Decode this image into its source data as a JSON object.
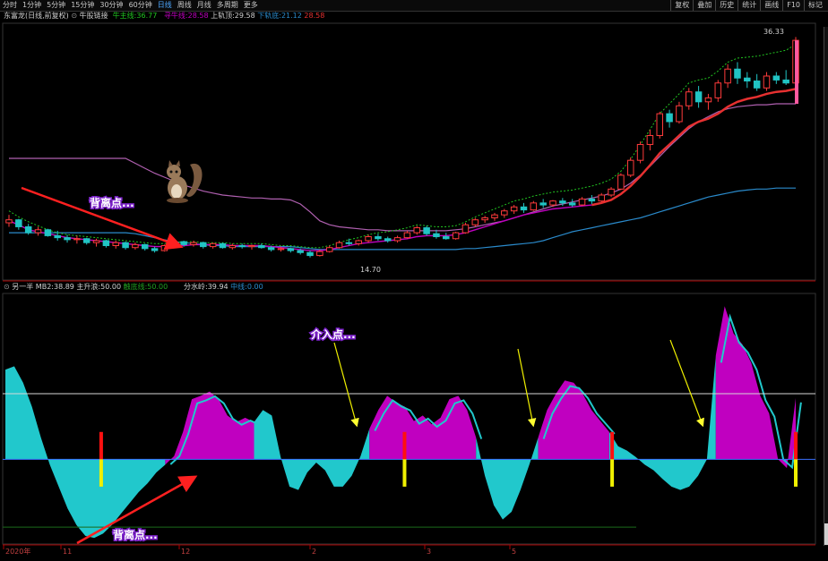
{
  "toolbar": {
    "items": [
      {
        "label": "分时",
        "active": false
      },
      {
        "label": "1分钟",
        "active": false
      },
      {
        "label": "5分钟",
        "active": false
      },
      {
        "label": "15分钟",
        "active": false
      },
      {
        "label": "30分钟",
        "active": false
      },
      {
        "label": "60分钟",
        "active": false
      },
      {
        "label": "日线",
        "active": true
      },
      {
        "label": "周线",
        "active": false
      },
      {
        "label": "月线",
        "active": false
      },
      {
        "label": "多周期",
        "active": false
      },
      {
        "label": "更多",
        "active": false
      }
    ],
    "right_items": [
      "复权",
      "叠加",
      "历史",
      "统计",
      "画线",
      "F10",
      "标记"
    ]
  },
  "colors": {
    "up": "#ff3b3b",
    "down": "#21c4c4",
    "magenta": "#c000c0",
    "cyan": "#21c8cc",
    "mid": "#f5f5f5",
    "ma": "#e63030",
    "upper_band": "#b060b0",
    "lower_band": "#2a8acb",
    "yellow": "#f0f000"
  },
  "main_info": {
    "stock": "东富龙(日线,前复权)",
    "indicator": "牛股链接",
    "bull_label": "牛主线:",
    "bull_value": "36.77",
    "seek_label": "寻牛线:",
    "seek_value": "28.58",
    "upper_label": "上轨顶:",
    "upper_value": "29.58",
    "lower_label": "下轨底:",
    "lower_value": "21.12",
    "extra_value": "28.58"
  },
  "sub_info": {
    "name": "另一半",
    "mb2_label": "MB2:",
    "mb2_value": "38.89",
    "main_label": "主升浪:",
    "main_value": "50.00",
    "support_label": "触底线:",
    "support_value": "50.00",
    "water_label": "分水岭:",
    "water_value": "39.94",
    "mid_label": "中线:",
    "mid_value": "0.00"
  },
  "annotations": {
    "top_divergence": "背离点...",
    "entry": "介入点...",
    "bottom_divergence": "背离点..."
  },
  "chart_data": [
    {
      "type": "candlestick",
      "title": "东富龙(日线,前复权)",
      "max_label": "36.33",
      "min_label": "14.70",
      "ylim": [
        13,
        37
      ],
      "candles": [
        [
          17.6,
          18.4,
          17.2,
          17.9
        ],
        [
          17.9,
          18.0,
          16.9,
          17.2
        ],
        [
          17.2,
          17.5,
          16.4,
          16.6
        ],
        [
          16.6,
          17.2,
          16.3,
          16.9
        ],
        [
          16.9,
          17.0,
          16.2,
          16.3
        ],
        [
          16.3,
          16.8,
          15.8,
          16.1
        ],
        [
          16.1,
          16.4,
          15.6,
          15.9
        ],
        [
          15.9,
          16.3,
          15.5,
          16.0
        ],
        [
          16.0,
          16.1,
          15.4,
          15.6
        ],
        [
          15.6,
          16.0,
          15.2,
          15.8
        ],
        [
          15.8,
          15.9,
          15.1,
          15.3
        ],
        [
          15.3,
          15.8,
          15.0,
          15.6
        ],
        [
          15.6,
          15.7,
          14.9,
          15.1
        ],
        [
          15.1,
          15.6,
          14.9,
          15.4
        ],
        [
          15.4,
          15.5,
          14.8,
          15.0
        ],
        [
          15.0,
          15.2,
          14.6,
          14.8
        ],
        [
          14.8,
          15.4,
          14.7,
          15.3
        ],
        [
          15.3,
          15.9,
          15.1,
          15.7
        ],
        [
          15.7,
          15.8,
          15.2,
          15.4
        ],
        [
          15.4,
          15.8,
          15.2,
          15.6
        ],
        [
          15.6,
          15.7,
          15.0,
          15.2
        ],
        [
          15.2,
          15.6,
          15.0,
          15.5
        ],
        [
          15.5,
          15.6,
          15.0,
          15.1
        ],
        [
          15.1,
          15.5,
          14.9,
          15.3
        ],
        [
          15.3,
          15.5,
          15.0,
          15.2
        ],
        [
          15.2,
          15.4,
          14.9,
          15.3
        ],
        [
          15.3,
          15.5,
          15.0,
          15.1
        ],
        [
          15.1,
          15.3,
          14.7,
          14.9
        ],
        [
          14.9,
          15.2,
          14.7,
          15.0
        ],
        [
          15.0,
          15.1,
          14.6,
          14.8
        ],
        [
          14.8,
          15.0,
          14.4,
          14.6
        ],
        [
          14.6,
          14.8,
          14.1,
          14.3
        ],
        [
          14.3,
          14.9,
          14.2,
          14.7
        ],
        [
          14.7,
          15.3,
          14.6,
          15.1
        ],
        [
          15.1,
          15.8,
          15.0,
          15.6
        ],
        [
          15.6,
          16.0,
          15.3,
          15.5
        ],
        [
          15.5,
          15.9,
          15.3,
          15.8
        ],
        [
          15.8,
          16.4,
          15.6,
          16.2
        ],
        [
          16.2,
          16.5,
          15.8,
          16.0
        ],
        [
          16.0,
          16.2,
          15.6,
          15.8
        ],
        [
          15.8,
          16.3,
          15.6,
          16.1
        ],
        [
          16.1,
          16.8,
          16.0,
          16.6
        ],
        [
          16.6,
          17.3,
          16.4,
          17.1
        ],
        [
          17.1,
          17.3,
          16.3,
          16.5
        ],
        [
          16.5,
          16.9,
          16.0,
          16.2
        ],
        [
          16.2,
          16.6,
          15.9,
          16.0
        ],
        [
          16.0,
          16.7,
          15.9,
          16.6
        ],
        [
          16.6,
          17.6,
          16.5,
          17.4
        ],
        [
          17.4,
          18.1,
          17.2,
          17.9
        ],
        [
          17.9,
          18.3,
          17.6,
          18.1
        ],
        [
          18.1,
          18.6,
          17.8,
          18.4
        ],
        [
          18.4,
          19.0,
          18.1,
          18.8
        ],
        [
          18.8,
          19.4,
          18.5,
          19.2
        ],
        [
          19.2,
          19.6,
          18.6,
          18.9
        ],
        [
          18.9,
          19.8,
          18.8,
          19.6
        ],
        [
          19.6,
          20.0,
          19.1,
          19.4
        ],
        [
          19.4,
          19.9,
          19.2,
          19.8
        ],
        [
          19.8,
          20.1,
          19.3,
          19.6
        ],
        [
          19.6,
          20.0,
          19.2,
          19.4
        ],
        [
          19.4,
          20.2,
          19.3,
          20.0
        ],
        [
          20.0,
          20.4,
          19.5,
          19.8
        ],
        [
          19.8,
          20.6,
          19.7,
          20.4
        ],
        [
          20.4,
          21.2,
          20.2,
          21.0
        ],
        [
          21.0,
          22.6,
          20.9,
          22.4
        ],
        [
          22.4,
          24.2,
          22.2,
          23.9
        ],
        [
          23.9,
          25.8,
          23.6,
          25.5
        ],
        [
          25.5,
          27.0,
          24.9,
          26.4
        ],
        [
          26.4,
          28.8,
          26.1,
          28.6
        ],
        [
          28.6,
          29.0,
          27.2,
          27.8
        ],
        [
          27.8,
          29.8,
          27.6,
          29.4
        ],
        [
          29.4,
          31.2,
          29.0,
          30.8
        ],
        [
          30.8,
          31.4,
          29.2,
          29.8
        ],
        [
          29.8,
          30.6,
          29.0,
          30.2
        ],
        [
          30.2,
          32.0,
          29.8,
          31.7
        ],
        [
          31.7,
          33.6,
          31.2,
          33.1
        ],
        [
          33.1,
          33.8,
          31.6,
          32.2
        ],
        [
          32.2,
          32.8,
          31.2,
          31.9
        ],
        [
          31.9,
          32.6,
          30.9,
          31.2
        ],
        [
          31.2,
          32.8,
          30.9,
          32.4
        ],
        [
          32.4,
          32.8,
          31.6,
          32.0
        ],
        [
          32.0,
          33.0,
          31.5,
          31.7
        ],
        [
          31.7,
          36.33,
          31.4,
          36.0
        ]
      ],
      "seek_line": [
        17.8,
        17.4,
        16.9,
        16.7,
        16.5,
        16.3,
        16.1,
        16.0,
        15.9,
        15.8,
        15.7,
        15.6,
        15.5,
        15.4,
        15.3,
        15.2,
        15.2,
        15.3,
        15.3,
        15.4,
        15.4,
        15.4,
        15.4,
        15.3,
        15.3,
        15.3,
        15.3,
        15.2,
        15.1,
        15.0,
        14.9,
        14.8,
        14.8,
        14.9,
        15.1,
        15.3,
        15.5,
        15.6,
        15.7,
        15.8,
        15.9,
        16.0,
        16.2,
        16.3,
        16.3,
        16.3,
        16.4,
        16.6,
        16.9,
        17.2,
        17.5,
        17.8,
        18.1,
        18.4,
        18.6,
        18.8,
        19.0,
        19.1,
        19.2,
        19.3,
        19.4,
        19.6,
        19.9,
        20.5,
        21.3,
        22.3,
        23.4,
        24.6,
        25.5,
        26.4,
        27.3,
        27.8,
        28.1,
        28.6,
        29.3,
        29.8,
        30.1,
        30.3,
        30.6,
        30.8,
        30.9,
        31.1
      ],
      "upper_band": [
        24.1,
        24.1,
        24.1,
        24.1,
        24.1,
        24.1,
        24.1,
        24.1,
        24.1,
        24.1,
        24.1,
        24.1,
        24.1,
        23.6,
        23.1,
        22.6,
        22.2,
        21.8,
        21.4,
        21.1,
        20.8,
        20.6,
        20.4,
        20.3,
        20.2,
        20.1,
        20.1,
        20.0,
        20.0,
        19.9,
        19.5,
        18.7,
        17.8,
        17.4,
        17.2,
        17.1,
        17.0,
        16.9,
        16.9,
        16.8,
        16.8,
        16.8,
        16.8,
        16.8,
        16.8,
        16.8,
        16.9,
        17.0,
        17.2,
        17.4,
        17.6,
        17.8,
        18.1,
        18.4,
        18.7,
        19.0,
        19.3,
        19.5,
        19.7,
        19.9,
        20.1,
        20.3,
        20.6,
        21.0,
        21.6,
        22.4,
        23.3,
        24.3,
        25.3,
        26.2,
        27.1,
        27.8,
        28.3,
        28.8,
        29.1,
        29.3,
        29.4,
        29.5,
        29.5,
        29.6,
        29.6,
        29.6
      ],
      "lower_band": [
        16.6,
        16.6,
        16.6,
        16.6,
        16.6,
        16.6,
        16.6,
        16.6,
        16.6,
        16.6,
        16.6,
        16.6,
        16.6,
        16.5,
        16.3,
        16.1,
        15.9,
        15.7,
        15.6,
        15.5,
        15.4,
        15.3,
        15.3,
        15.2,
        15.2,
        15.2,
        15.2,
        15.2,
        15.2,
        15.2,
        15.1,
        15.0,
        14.9,
        14.9,
        14.9,
        14.9,
        14.9,
        14.9,
        14.9,
        14.9,
        14.9,
        14.9,
        14.9,
        14.9,
        14.9,
        14.9,
        14.9,
        15.0,
        15.0,
        15.1,
        15.2,
        15.3,
        15.4,
        15.5,
        15.6,
        15.8,
        16.1,
        16.4,
        16.7,
        16.9,
        17.1,
        17.3,
        17.5,
        17.7,
        17.9,
        18.1,
        18.4,
        18.7,
        19.0,
        19.3,
        19.6,
        19.9,
        20.2,
        20.4,
        20.6,
        20.8,
        20.9,
        21.0,
        21.0,
        21.1,
        21.1,
        21.1
      ],
      "dotted_line": [
        18.8,
        18.2,
        17.7,
        17.3,
        16.9,
        16.6,
        16.4,
        16.3,
        16.2,
        16.1,
        16.0,
        15.9,
        15.8,
        15.7,
        15.6,
        15.5,
        15.5,
        15.6,
        15.7,
        15.7,
        15.6,
        15.6,
        15.6,
        15.5,
        15.5,
        15.5,
        15.5,
        15.4,
        15.3,
        15.3,
        15.2,
        15.1,
        15.1,
        15.3,
        15.6,
        15.9,
        16.1,
        16.4,
        16.6,
        16.7,
        16.9,
        17.1,
        17.4,
        17.3,
        17.2,
        17.2,
        17.3,
        17.7,
        18.2,
        18.6,
        19.0,
        19.4,
        19.8,
        20.0,
        20.3,
        20.5,
        20.7,
        20.8,
        20.9,
        21.1,
        21.3,
        21.6,
        22.0,
        22.8,
        24.0,
        25.5,
        27.0,
        28.6,
        29.6,
        30.6,
        31.7,
        32.0,
        32.2,
        32.9,
        33.8,
        34.2,
        34.3,
        34.4,
        34.6,
        34.8,
        35.0,
        35.6
      ]
    },
    {
      "type": "area",
      "title": "另一半",
      "ylim": [
        -75,
        150
      ],
      "reference_lines": [
        {
          "name": "分水岭",
          "value": 60
        },
        {
          "name": "中线",
          "value": 0
        }
      ],
      "values": [
        82,
        85,
        70,
        48,
        20,
        -5,
        -25,
        -45,
        -60,
        -70,
        -72,
        -68,
        -60,
        -50,
        -40,
        -30,
        -22,
        -12,
        -5,
        3,
        25,
        55,
        58,
        62,
        55,
        40,
        34,
        38,
        34,
        45,
        40,
        2,
        -25,
        -28,
        -12,
        -3,
        -10,
        -25,
        -25,
        -15,
        3,
        28,
        45,
        58,
        52,
        48,
        35,
        40,
        32,
        38,
        55,
        58,
        45,
        20,
        -15,
        -42,
        -55,
        -48,
        -28,
        -5,
        20,
        45,
        60,
        72,
        70,
        60,
        45,
        35,
        25,
        12,
        8,
        2,
        -5,
        -10,
        -18,
        -25,
        -28,
        -25,
        -15,
        0,
        95,
        140,
        115,
        105,
        88,
        58,
        42,
        0,
        -8,
        56
      ],
      "regions": [
        {
          "color": "cyan",
          "from": 0,
          "to": 18
        },
        {
          "color": "magenta",
          "from": 18,
          "to": 28
        },
        {
          "color": "cyan",
          "from": 28,
          "to": 41
        },
        {
          "color": "magenta",
          "from": 41,
          "to": 53
        },
        {
          "color": "cyan",
          "from": 53,
          "to": 60
        },
        {
          "color": "magenta",
          "from": 60,
          "to": 68
        },
        {
          "color": "cyan",
          "from": 68,
          "to": 80
        },
        {
          "color": "magenta",
          "from": 80,
          "to": 89
        }
      ],
      "signals": [
        {
          "index": 12
        },
        {
          "index": 50
        },
        {
          "index": 76
        },
        {
          "index": 99
        }
      ],
      "x_labels": [
        "2020年",
        "11",
        "12",
        "2",
        "3",
        "5"
      ]
    }
  ]
}
